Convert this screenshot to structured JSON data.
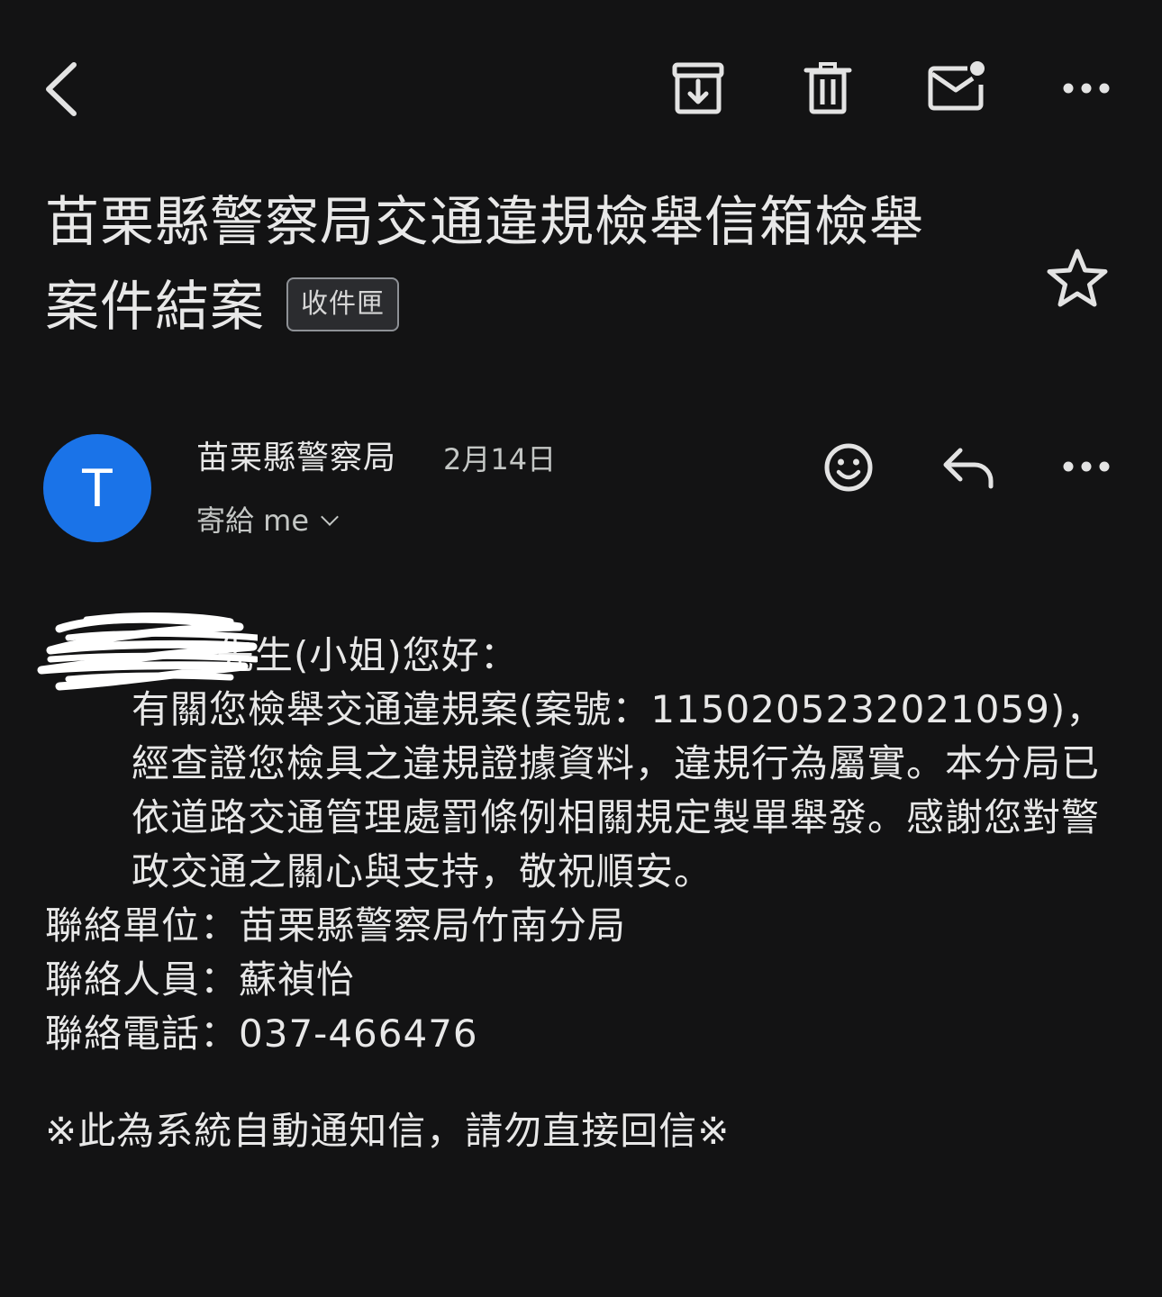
{
  "toolbar": {
    "back_icon": "arrow-back-icon",
    "archive_icon": "archive-icon",
    "delete_icon": "trash-icon",
    "mark_unread_icon": "mail-unread-icon",
    "more_icon": "more-horizontal-icon"
  },
  "subject": {
    "title": "苗栗縣警察局交通違規檢舉信箱檢舉案件結案",
    "label": "收件匣",
    "star_icon": "star-outline-icon"
  },
  "message": {
    "avatar_letter": "T",
    "avatar_color": "#1a73e8",
    "sender": "苗栗縣警察局",
    "date": "2月14日",
    "recipient": "寄給 me",
    "actions": {
      "emoji_icon": "emoji-reaction-icon",
      "reply_icon": "reply-icon",
      "more_icon": "more-horizontal-icon"
    }
  },
  "body": {
    "greeting": "先生(小姐)您好：",
    "paragraph": "有關您檢舉交通違規案(案號：1150205232021059)，經查證您檢具之違規證據資料，違規行為屬實。本分局已依道路交通管理處罰條例相關規定製單舉發。感謝您對警政交通之關心與支持，敬祝順安。",
    "contact_unit": "聯絡單位：苗栗縣警察局竹南分局",
    "contact_person": "聯絡人員：蘇禎怡",
    "contact_phone": "聯絡電話：037-466476",
    "notice": "※此為系統自動通知信，請勿直接回信※"
  },
  "colors": {
    "background": "#131314",
    "text": "#e8e8e8",
    "secondary_text": "#c4c7c5",
    "icon": "#e3e3e3"
  }
}
